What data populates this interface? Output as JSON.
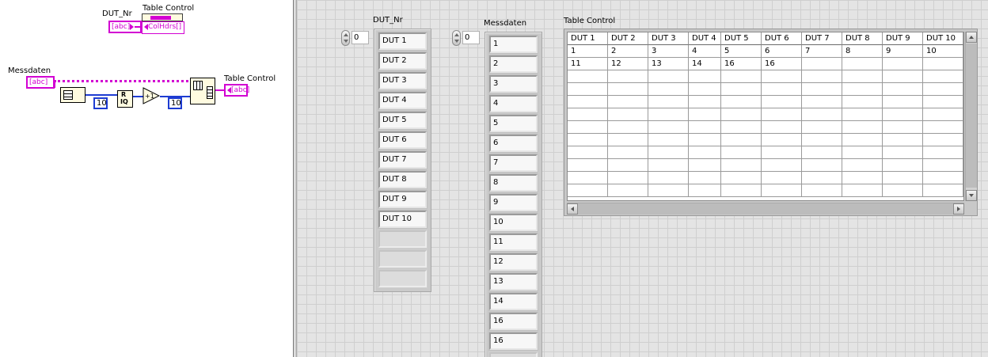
{
  "block_diagram": {
    "labels": {
      "dut_nr": "DUT_Nr",
      "table_control_top": "Table Control",
      "messdaten": "Messdaten",
      "table_control_right": "Table Control"
    },
    "terminals": {
      "dut_nr_type": "[abc]",
      "messdaten_type": "[abc]",
      "table_control_out_type": "[abc]",
      "col_hdrs": "ColHdrs[]"
    },
    "constants": {
      "rows_const": "10",
      "cols_const": "10"
    },
    "icons": {
      "string_to_array": "spreadsheet-string-icon",
      "quotient_remainder": "quotient-remainder-icon",
      "increment": "increment-icon",
      "reshape_array": "reshape-array-icon",
      "table_property_node": "table-icon"
    }
  },
  "front_panel": {
    "dut_nr": {
      "label": "DUT_Nr",
      "index": "0",
      "items": [
        "DUT 1",
        "DUT 2",
        "DUT 3",
        "DUT 4",
        "DUT 5",
        "DUT 6",
        "DUT 7",
        "DUT 8",
        "DUT 9",
        "DUT 10",
        "",
        "",
        ""
      ]
    },
    "messdaten": {
      "label": "Messdaten",
      "index": "0",
      "items": [
        "1",
        "2",
        "3",
        "4",
        "5",
        "6",
        "7",
        "8",
        "9",
        "10",
        "11",
        "12",
        "13",
        "14",
        "16",
        "16",
        ""
      ]
    },
    "table_control": {
      "label": "Table Control",
      "headers": [
        "DUT 1",
        "DUT 2",
        "DUT 3",
        "DUT 4",
        "DUT 5",
        "DUT 6",
        "DUT 7",
        "DUT 8",
        "DUT 9",
        "DUT 10"
      ],
      "rows": [
        [
          "1",
          "2",
          "3",
          "4",
          "5",
          "6",
          "7",
          "8",
          "9",
          "10"
        ],
        [
          "11",
          "12",
          "13",
          "14",
          "16",
          "16",
          "",
          "",
          "",
          ""
        ]
      ],
      "empty_rows": 10
    }
  },
  "colors": {
    "string_wire": "#d200d2",
    "numeric_wire": "#1e3cd2",
    "panel_bg": "#e4e4e4"
  }
}
